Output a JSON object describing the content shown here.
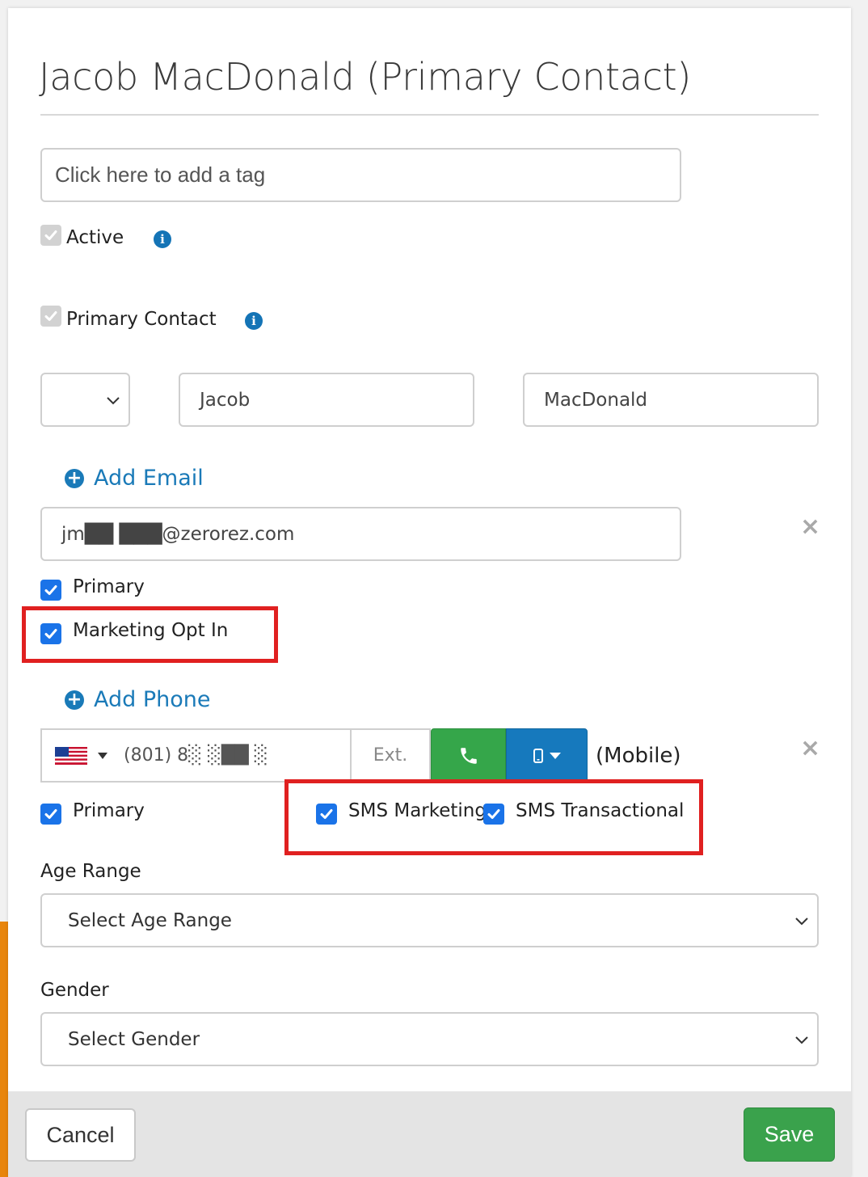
{
  "title": "Jacob MacDonald (Primary Contact)",
  "tag_input": {
    "placeholder": "Click here to add a tag"
  },
  "active": {
    "label": "Active",
    "checked": true
  },
  "primary_contact": {
    "label": "Primary Contact",
    "checked": true
  },
  "name": {
    "salutation_value": "",
    "first_name": "Jacob",
    "last_name": "MacDonald"
  },
  "email_section": {
    "add_label": "Add Email",
    "email_value": "jm██  ███@zerorez.com",
    "primary_label": "Primary",
    "marketing_opt_in_label": "Marketing Opt In"
  },
  "phone_section": {
    "add_label": "Add Phone",
    "phone_value": "(801) 8░ ░██ ░",
    "ext_placeholder": "Ext.",
    "type_label": "(Mobile)",
    "primary_label": "Primary",
    "sms_marketing_label": "SMS Marketing",
    "sms_transactional_label": "SMS Transactional"
  },
  "age_range": {
    "label": "Age Range",
    "placeholder": "Select Age Range"
  },
  "gender": {
    "label": "Gender",
    "placeholder": "Select Gender"
  },
  "footer": {
    "cancel_label": "Cancel",
    "save_label": "Save"
  },
  "colors": {
    "accent_blue": "#1a7ab8",
    "checkbox_blue": "#1a73e8",
    "call_green": "#35a64a",
    "save_green": "#3aa24c",
    "highlight_red": "#e02020",
    "side_tab_orange": "#e8850c"
  },
  "icons": [
    "info-icon",
    "plus-circle-icon",
    "close-icon",
    "phone-icon",
    "mobile-icon",
    "caret-down-icon",
    "chevron-down-icon",
    "us-flag-icon",
    "checkmark-icon"
  ]
}
